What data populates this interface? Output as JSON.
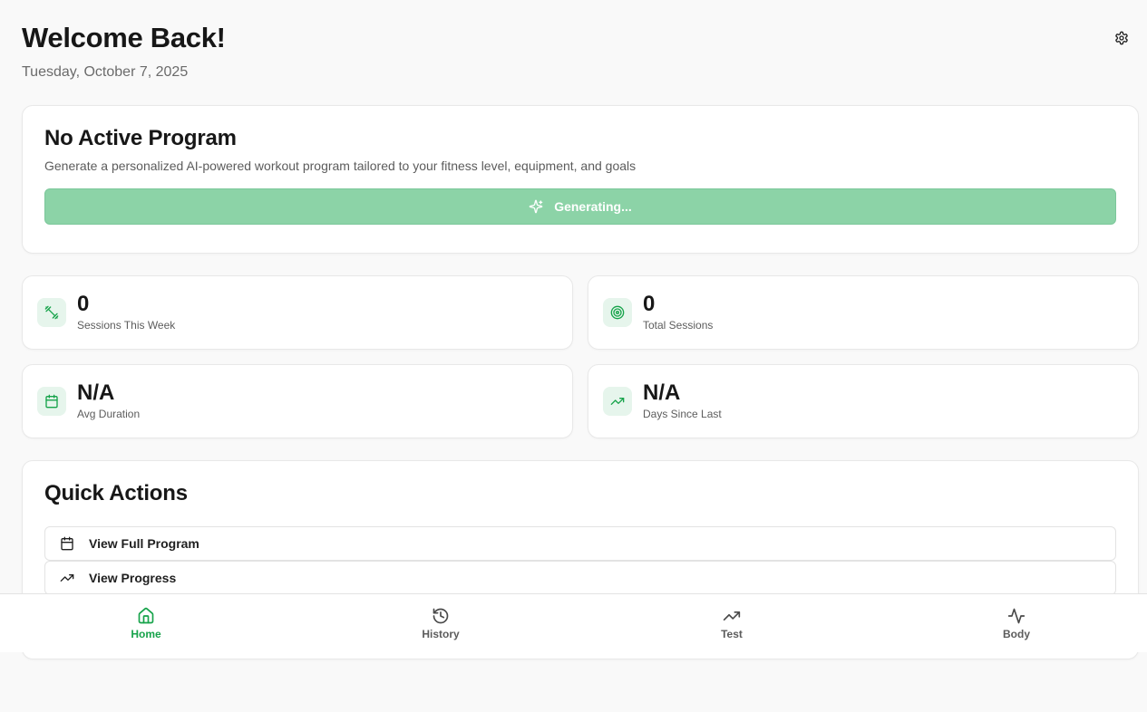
{
  "header": {
    "title": "Welcome Back!",
    "date": "Tuesday, October 7, 2025",
    "settings_icon": "gear-icon"
  },
  "program": {
    "title": "No Active Program",
    "description": "Generate a personalized AI-powered workout program tailored to your fitness level, equipment, and goals",
    "button_label": "Generating...",
    "button_icon": "sparkles-icon",
    "button_color": "#8cd3a7"
  },
  "stats": [
    {
      "value": "0",
      "label": "Sessions This Week",
      "icon": "dumbbell-icon"
    },
    {
      "value": "0",
      "label": "Total Sessions",
      "icon": "target-icon"
    },
    {
      "value": "N/A",
      "label": "Avg Duration",
      "icon": "calendar-icon"
    },
    {
      "value": "N/A",
      "label": "Days Since Last",
      "icon": "trending-up-icon"
    }
  ],
  "quick_actions": {
    "title": "Quick Actions",
    "items": [
      {
        "label": "View Full Program",
        "icon": "calendar-icon"
      },
      {
        "label": "View Progress",
        "icon": "trending-up-icon"
      }
    ]
  },
  "nav": {
    "active": "Home",
    "accent": "#16a34a",
    "items": [
      {
        "label": "Home",
        "icon": "home-icon"
      },
      {
        "label": "History",
        "icon": "history-icon"
      },
      {
        "label": "Test",
        "icon": "trending-up-icon"
      },
      {
        "label": "Body",
        "icon": "activity-icon"
      }
    ]
  }
}
